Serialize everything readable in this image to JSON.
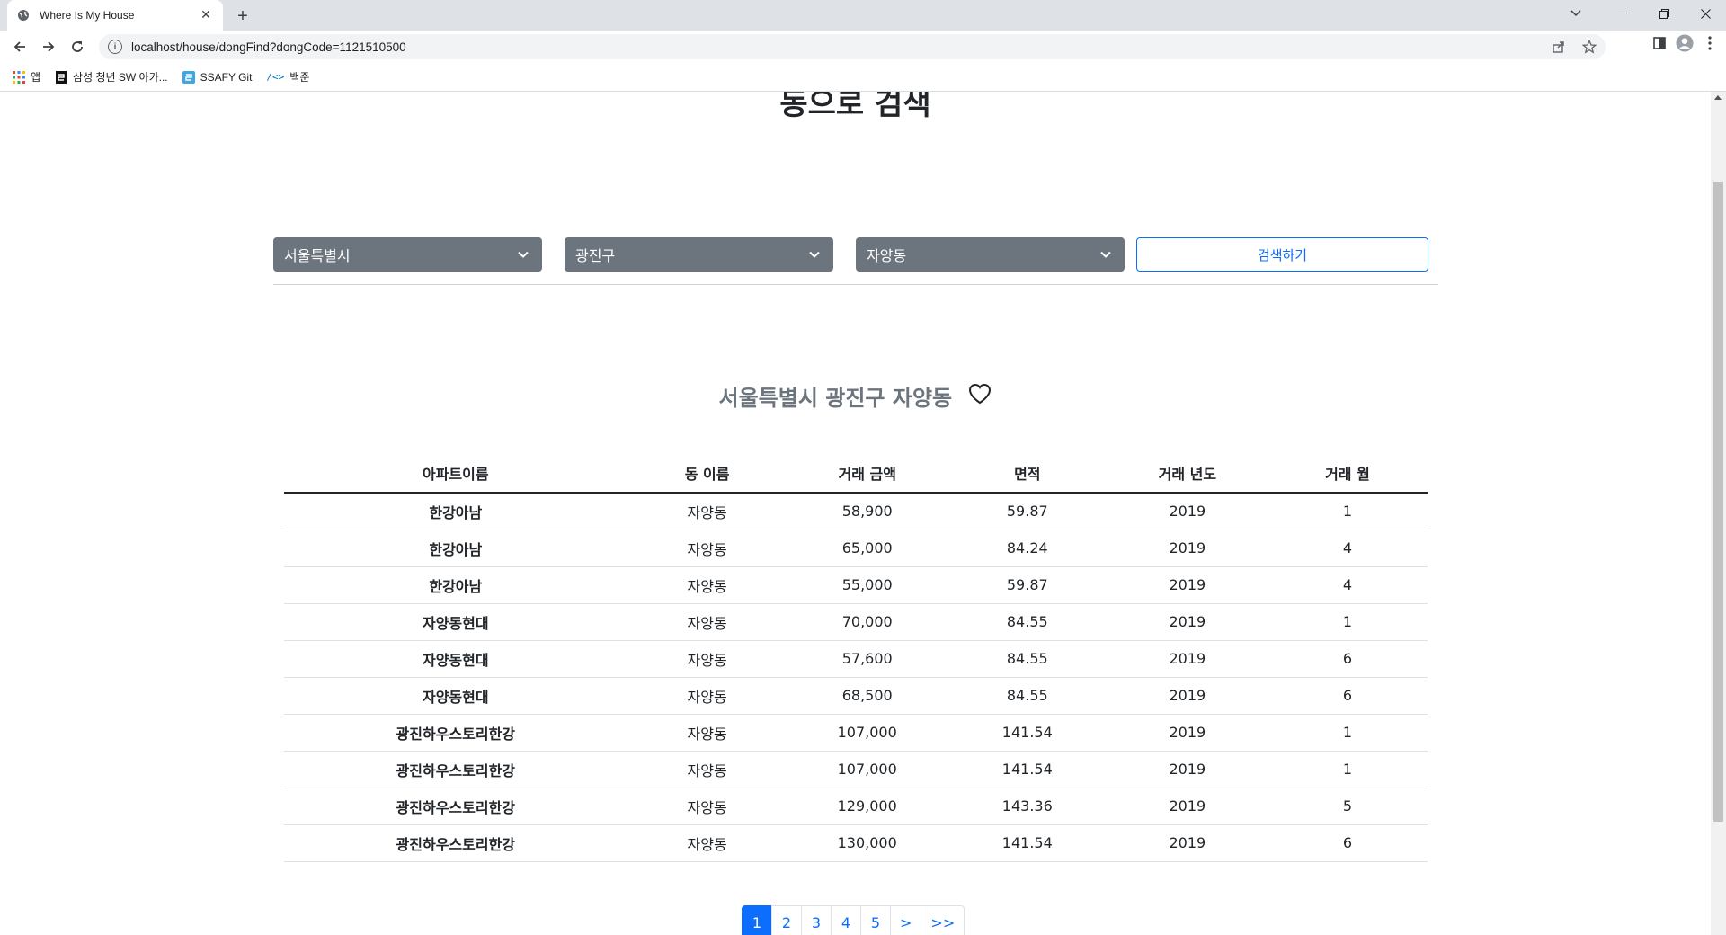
{
  "browser": {
    "tab_title": "Where Is My House",
    "url": "localhost/house/dongFind?dongCode=1121510500",
    "bookmarks": [
      {
        "label": "앱",
        "icon": "apps-grid-icon"
      },
      {
        "label": "삼성 청년 SW 아카...",
        "icon": "ssafy-logo-icon"
      },
      {
        "label": "SSAFY Git",
        "icon": "gitlab-icon"
      },
      {
        "label": "백준",
        "icon": "code-icon"
      }
    ]
  },
  "page": {
    "title": "동으로 검색",
    "selects": {
      "sido": "서울특별시",
      "gugun": "광진구",
      "dong": "자양동"
    },
    "search_button": "검색하기",
    "region_title": "서울특별시 광진구 자양동"
  },
  "table": {
    "headers": [
      "아파트이름",
      "동 이름",
      "거래 금액",
      "면적",
      "거래 년도",
      "거래 월"
    ],
    "rows": [
      [
        "한강아남",
        "자양동",
        "58,900",
        "59.87",
        "2019",
        "1"
      ],
      [
        "한강아남",
        "자양동",
        "65,000",
        "84.24",
        "2019",
        "4"
      ],
      [
        "한강아남",
        "자양동",
        "55,000",
        "59.87",
        "2019",
        "4"
      ],
      [
        "자양동현대",
        "자양동",
        "70,000",
        "84.55",
        "2019",
        "1"
      ],
      [
        "자양동현대",
        "자양동",
        "57,600",
        "84.55",
        "2019",
        "6"
      ],
      [
        "자양동현대",
        "자양동",
        "68,500",
        "84.55",
        "2019",
        "6"
      ],
      [
        "광진하우스토리한강",
        "자양동",
        "107,000",
        "141.54",
        "2019",
        "1"
      ],
      [
        "광진하우스토리한강",
        "자양동",
        "107,000",
        "141.54",
        "2019",
        "1"
      ],
      [
        "광진하우스토리한강",
        "자양동",
        "129,000",
        "143.36",
        "2019",
        "5"
      ],
      [
        "광진하우스토리한강",
        "자양동",
        "130,000",
        "141.54",
        "2019",
        "6"
      ]
    ]
  },
  "pagination": {
    "pages": [
      "1",
      "2",
      "3",
      "4",
      "5"
    ],
    "active": "1",
    "next": ">",
    "last": ">>"
  },
  "colors": {
    "primary": "#0d6efd",
    "secondary": "#6c757d"
  }
}
